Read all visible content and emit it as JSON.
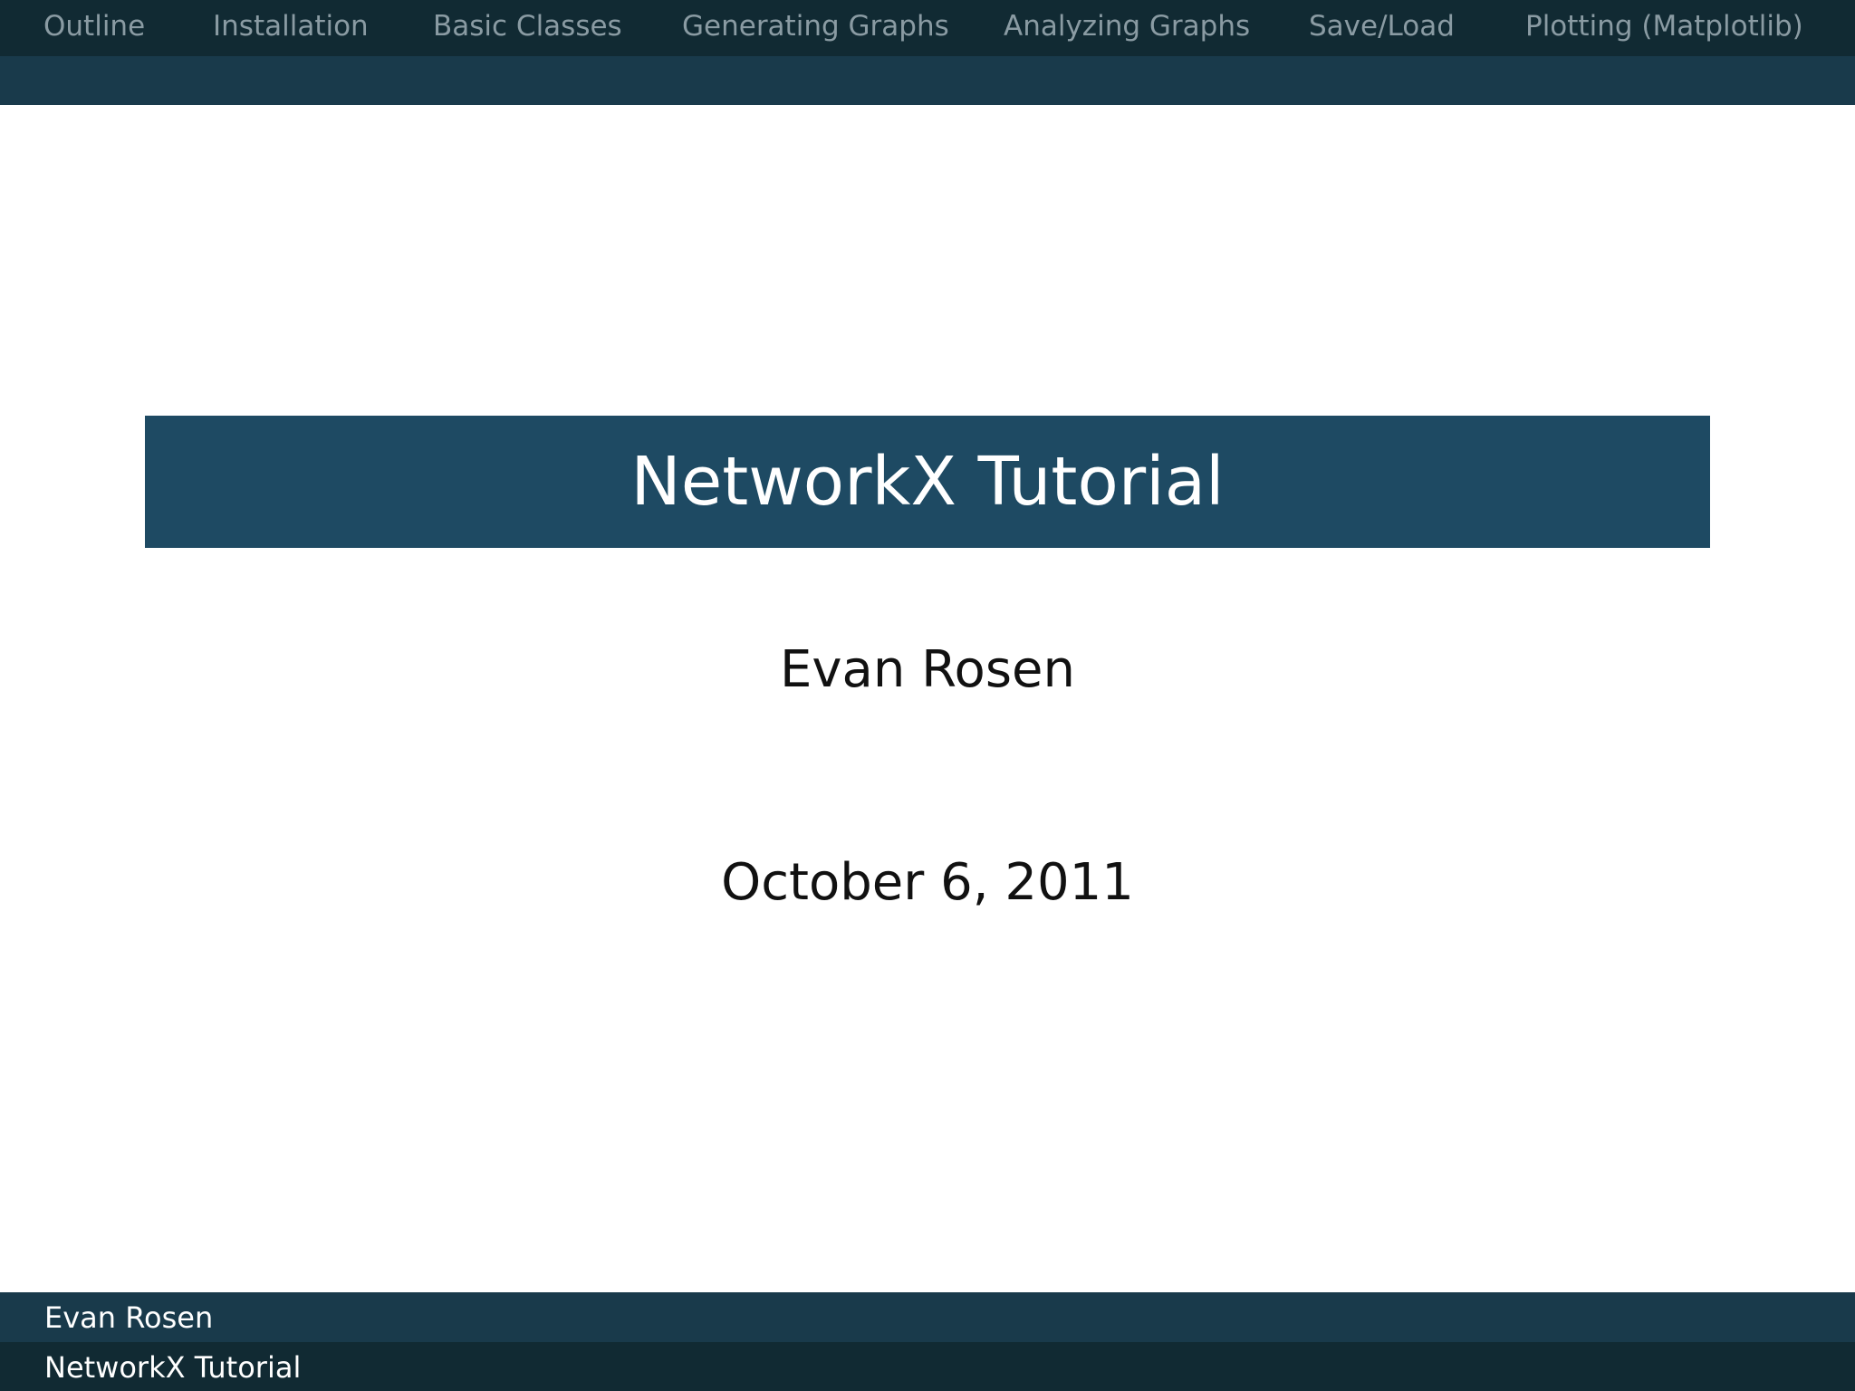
{
  "nav": {
    "items": [
      "Outline",
      "Installation",
      "Basic Classes",
      "Generating Graphs",
      "Analyzing Graphs",
      "Save/Load",
      "Plotting (Matplotlib)"
    ]
  },
  "title": "NetworkX Tutorial",
  "author": "Evan Rosen",
  "date": "October 6, 2011",
  "footer": {
    "author": "Evan Rosen",
    "title": "NetworkX Tutorial"
  },
  "colors": {
    "nav_dark": "#112a33",
    "nav_mid": "#193a4b",
    "title_block": "#1e4a63",
    "nav_text": "#8a9ba3"
  }
}
